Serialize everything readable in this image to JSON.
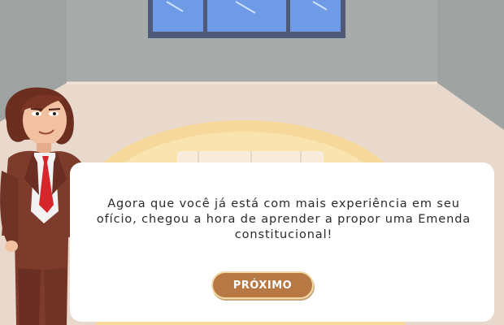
{
  "dialog": {
    "text": "Agora que você já está com mais experiência em seu ofício, chegou a hora de aprender a propor uma Emenda constitucional!",
    "next_button_label": "PRÓXIMO"
  },
  "colors": {
    "wall": "#a3a8a6",
    "floor": "#e8d9cc",
    "window_frame": "#4f5a7a",
    "window_glass": "#6f9be6",
    "table": "#f6d99a",
    "button": "#b87844",
    "dialog_bg": "#ffffff"
  }
}
